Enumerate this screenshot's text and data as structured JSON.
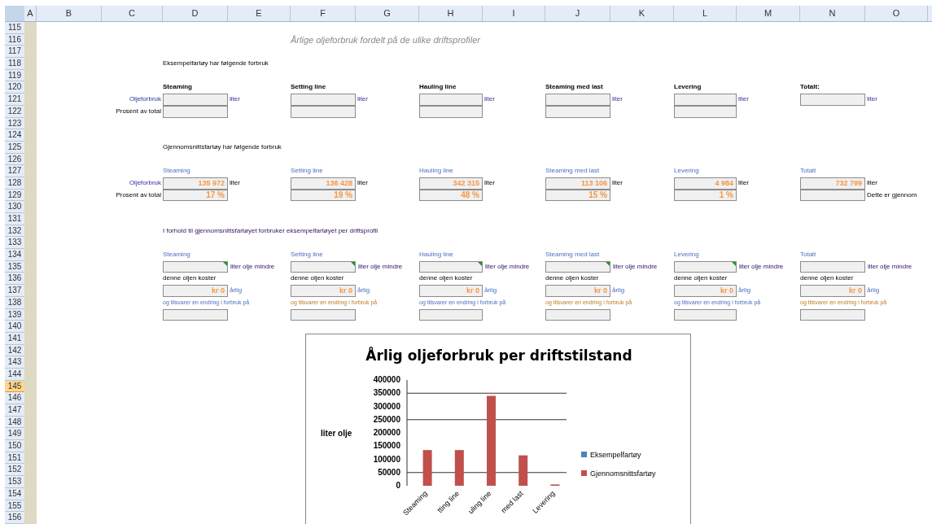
{
  "column_headers": [
    "A",
    "B",
    "C",
    "D",
    "E",
    "F",
    "G",
    "H",
    "I",
    "J",
    "K",
    "L",
    "M",
    "N",
    "O"
  ],
  "row_headers": [
    {
      "label": "115",
      "selected": false
    },
    {
      "label": "116",
      "selected": false
    },
    {
      "label": "117",
      "selected": false
    },
    {
      "label": "118",
      "selected": false
    },
    {
      "label": "119",
      "selected": false
    },
    {
      "label": "120",
      "selected": false
    },
    {
      "label": "121",
      "selected": false
    },
    {
      "label": "122",
      "selected": false
    },
    {
      "label": "123",
      "selected": false
    },
    {
      "label": "124",
      "selected": false
    },
    {
      "label": "125",
      "selected": false
    },
    {
      "label": "126",
      "selected": false
    },
    {
      "label": "127",
      "selected": false
    },
    {
      "label": "128",
      "selected": false
    },
    {
      "label": "129",
      "selected": false
    },
    {
      "label": "130",
      "selected": false
    },
    {
      "label": "131",
      "selected": false
    },
    {
      "label": "132",
      "selected": false
    },
    {
      "label": "133",
      "selected": false
    },
    {
      "label": "134",
      "selected": false
    },
    {
      "label": "135",
      "selected": false
    },
    {
      "label": "136",
      "selected": false
    },
    {
      "label": "137",
      "selected": false
    },
    {
      "label": "138",
      "selected": false
    },
    {
      "label": "139",
      "selected": false
    },
    {
      "label": "140",
      "selected": false
    },
    {
      "label": "141",
      "selected": false
    },
    {
      "label": "142",
      "selected": false
    },
    {
      "label": "143",
      "selected": false
    },
    {
      "label": "144",
      "selected": false
    },
    {
      "label": "145",
      "selected": true
    },
    {
      "label": "146",
      "selected": false
    },
    {
      "label": "147",
      "selected": false
    },
    {
      "label": "148",
      "selected": false
    },
    {
      "label": "149",
      "selected": false
    },
    {
      "label": "150",
      "selected": false
    },
    {
      "label": "151",
      "selected": false
    },
    {
      "label": "152",
      "selected": false
    },
    {
      "label": "153",
      "selected": false
    },
    {
      "label": "154",
      "selected": false
    },
    {
      "label": "155",
      "selected": false
    },
    {
      "label": "156",
      "selected": false
    }
  ],
  "sheet_title": "Årlige oljeforbruk fordelt på de ulike driftsprofiler",
  "example_section": {
    "heading": "Eksempelfartøy har følgende forbruk",
    "row_labels": [
      "Oljeforbruk",
      "Prosent av total"
    ],
    "profiles": [
      {
        "kind": "profile",
        "name": "Steaming",
        "unit": "liter"
      },
      {
        "kind": "profile",
        "name": "Setting line",
        "unit": "liter"
      },
      {
        "kind": "profile",
        "name": "Hauling line",
        "unit": "liter"
      },
      {
        "kind": "profile",
        "name": "Steaming med last",
        "unit": "liter"
      },
      {
        "kind": "profile",
        "name": "Levering",
        "unit": "liter"
      },
      {
        "kind": "total",
        "name": "Totalt:",
        "unit": "liter"
      }
    ]
  },
  "average_section": {
    "heading": "Gjennomsnittsfartøy har følgende forbruk",
    "row_labels": [
      "Oljeforbruk",
      "Prosent av total"
    ],
    "profiles": [
      {
        "name": "Steaming",
        "consumption": "135 972",
        "unit": "liter",
        "share": "17 %"
      },
      {
        "name": "Setting line",
        "consumption": "136 428",
        "unit": "liter",
        "share": "19 %"
      },
      {
        "name": "Hauling line",
        "consumption": "342 315",
        "unit": "liter",
        "share": "48 %"
      },
      {
        "name": "Steaming med last",
        "consumption": "113 106",
        "unit": "liter",
        "share": "15 %"
      },
      {
        "name": "Levering",
        "consumption": "4 984",
        "unit": "liter",
        "share": "1 %"
      },
      {
        "name": "Totalt",
        "consumption": "732 799",
        "unit": "liter"
      }
    ],
    "note": "Dette er gjennom"
  },
  "comparison_section": {
    "heading": "I forhold til gjennomsnittsfartøyet forbruker eksempelfartøyet per driftsprofil",
    "profiles": [
      {
        "kind": "profile",
        "name": "Steaming",
        "difference_label": "liter olje mindre",
        "cost_label": "denne oljen koster",
        "cost": "kr 0",
        "period": "årlig",
        "change_label": "og tilsvarer en endring i forbruk på"
      },
      {
        "kind": "profile",
        "name": "Setting line",
        "difference_label": "liter olje mindre",
        "cost_label": "denne oljen koster",
        "cost": "kr 0",
        "period": "årlig",
        "change_label": "og tilsvarer en endring i forbruk på"
      },
      {
        "kind": "profile",
        "name": "Hauling line",
        "difference_label": "liter olje mindre",
        "cost_label": "denne oljen koster",
        "cost": "kr 0",
        "period": "årlig",
        "change_label": "og tilsvarer en endring i forbruk på"
      },
      {
        "kind": "profile",
        "name": "Steaming med last",
        "difference_label": "liter olje mindre",
        "cost_label": "denne oljen koster",
        "cost": "kr 0",
        "period": "årlig",
        "change_label": "og tilsvarer en endring i forbruk på"
      },
      {
        "kind": "profile",
        "name": "Levering",
        "difference_label": "liter olje mindre",
        "cost_label": "denne oljen koster",
        "cost": "kr 0",
        "period": "årlig",
        "change_label": "og tilsvarer en endring i forbruk på"
      },
      {
        "kind": "total",
        "name": "Totalt",
        "difference_label": "liter olje mindre",
        "cost_label": "denne oljen koster",
        "cost": "kr 0",
        "period": "årlig",
        "change_label": "og tilsvarer en endring i forbruk på"
      }
    ]
  },
  "chart": {
    "chart_data": {
      "type": "bar",
      "title": "Årlig oljeforbruk per driftstilstand",
      "ylabel": "liter olje",
      "categories": [
        "Steaming",
        "tting line",
        "uling line",
        "med last",
        "Levering"
      ],
      "series": [
        {
          "name": "Eksempelfartøy",
          "color": "#4f81bd",
          "values": [
            0,
            0,
            0,
            0,
            0
          ]
        },
        {
          "name": "Gjennomsnittsfartøy",
          "color": "#c0504d",
          "values": [
            135000,
            135000,
            340000,
            115000,
            5000
          ]
        }
      ],
      "grid": true,
      "ylim": [
        0,
        400000
      ],
      "yticks": [
        0,
        50000,
        100000,
        150000,
        200000,
        250000,
        300000,
        350000,
        400000
      ]
    }
  }
}
